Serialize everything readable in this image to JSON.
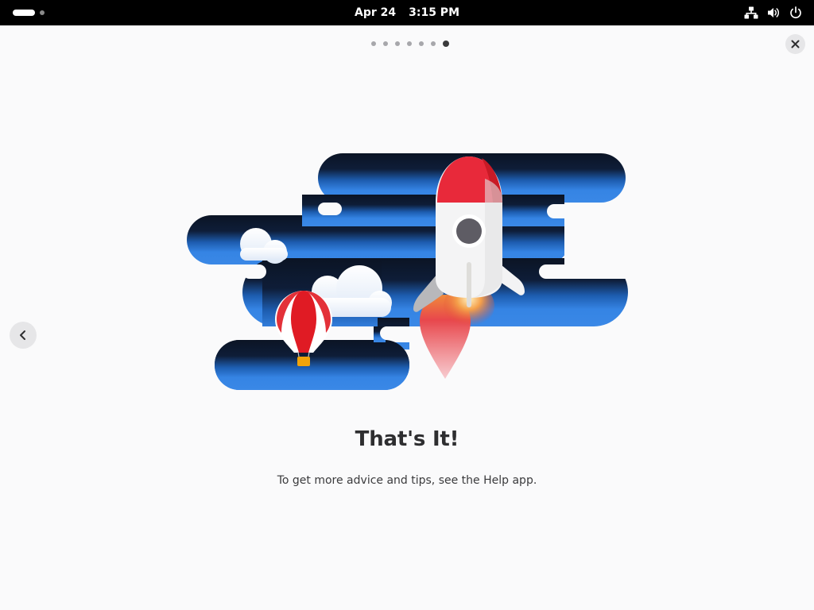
{
  "topbar": {
    "date": "Apr 24",
    "time": "3:15 PM",
    "icons": [
      "network-wired-icon",
      "volume-icon",
      "power-icon"
    ]
  },
  "pager": {
    "total_pages": 7,
    "current_page": 7
  },
  "page": {
    "title": "That's It!",
    "subtitle": "To get more advice and tips, see the Help app."
  },
  "colors": {
    "sky_dark": "#0b1424",
    "sky_light": "#3584e4",
    "rocket_red": "#e8293a",
    "background": "#fafafb"
  }
}
